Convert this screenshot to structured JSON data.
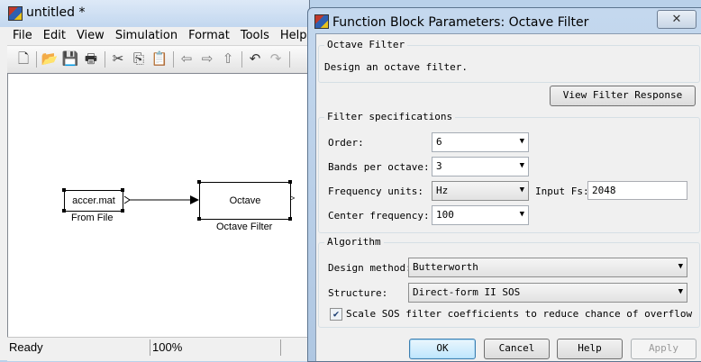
{
  "model_window": {
    "title": "untitled *",
    "menu": [
      "File",
      "Edit",
      "View",
      "Simulation",
      "Format",
      "Tools",
      "Help"
    ],
    "toolbar_icons": [
      "new-icon",
      "open-icon",
      "save-icon",
      "print-icon",
      "cut-icon",
      "copy-icon",
      "paste-icon",
      "back-icon",
      "forward-icon",
      "up-icon",
      "undo-icon",
      "redo-icon"
    ],
    "blocks": {
      "from_file": {
        "content": "accer.mat",
        "label": "From File"
      },
      "octave_filter": {
        "content": "Octave",
        "label": "Octave Filter"
      }
    },
    "status": {
      "text": "Ready",
      "zoom": "100%"
    }
  },
  "dialog": {
    "title": "Function Block Parameters: Octave Filter",
    "close_glyph": "✕",
    "header_group": {
      "title": "Octave Filter",
      "description": "Design an octave filter."
    },
    "view_response_label": "View Filter Response",
    "spec_group": {
      "title": "Filter specifications",
      "order_label": "Order:",
      "order_value": "6",
      "bands_label": "Bands per octave:",
      "bands_value": "3",
      "freq_units_label": "Frequency units:",
      "freq_units_value": "Hz",
      "input_fs_label": "Input Fs:",
      "input_fs_value": "2048",
      "center_label": "Center frequency:",
      "center_value": "100"
    },
    "algorithm_group": {
      "title": "Algorithm",
      "method_label": "Design method:",
      "method_value": "Butterworth",
      "structure_label": "Structure:",
      "structure_value": "Direct-form II SOS",
      "scale_label": "Scale SOS filter coefficients to reduce chance of overflow",
      "scale_checked": true
    },
    "buttons": {
      "ok": "OK",
      "cancel": "Cancel",
      "help": "Help",
      "apply": "Apply"
    }
  },
  "colors": {
    "title_gradient": "#c2d7ef",
    "dialog_body": "#f0f0f0",
    "default_button": "#bee6fd"
  }
}
